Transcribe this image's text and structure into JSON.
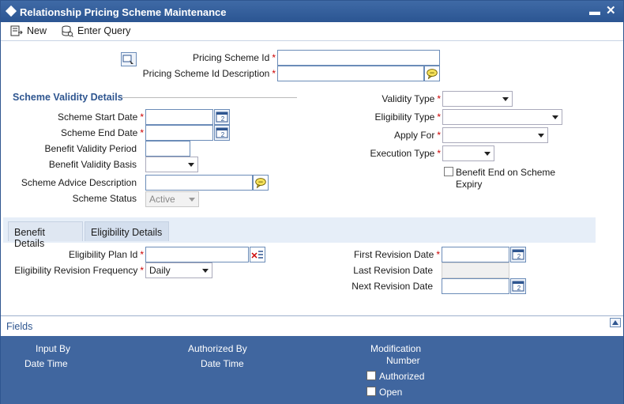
{
  "window": {
    "title": "Relationship Pricing Scheme Maintenance",
    "minimize": "▬",
    "close": "✕"
  },
  "toolbar": {
    "new_label": "New",
    "enter_query_label": "Enter Query"
  },
  "header_fields": {
    "pricing_scheme_id_label": "Pricing Scheme Id",
    "pricing_scheme_id_value": "",
    "pricing_scheme_desc_label": "Pricing Scheme Id Description",
    "pricing_scheme_desc_value": ""
  },
  "required_mark": "*",
  "scheme_validity": {
    "section_title": "Scheme Validity Details",
    "start_date_label": "Scheme Start Date",
    "start_date_value": "",
    "end_date_label": "Scheme End Date",
    "end_date_value": "",
    "benefit_validity_period_label": "Benefit Validity Period",
    "benefit_validity_period_value": "",
    "benefit_validity_basis_label": "Benefit Validity Basis",
    "benefit_validity_basis_value": "",
    "advice_description_label": "Scheme Advice Description",
    "advice_description_value": "",
    "scheme_status_label": "Scheme Status",
    "scheme_status_value": "Active"
  },
  "right_fields": {
    "validity_type_label": "Validity Type",
    "validity_type_value": "",
    "eligibility_type_label": "Eligibility Type",
    "eligibility_type_value": "",
    "apply_for_label": "Apply For",
    "apply_for_value": "",
    "execution_type_label": "Execution Type",
    "execution_type_value": "",
    "benefit_end_label_line1": "Benefit End on Scheme",
    "benefit_end_label_line2": "Expiry",
    "benefit_end_checked": false
  },
  "tabs": [
    {
      "label": "Benefit Details"
    },
    {
      "label": "Eligibility Details"
    }
  ],
  "eligibility": {
    "plan_id_label": "Eligibility Plan Id",
    "plan_id_value": "",
    "revision_frequency_label": "Eligibility Revision Frequency",
    "revision_frequency_value": "Daily",
    "first_revision_label": "First Revision Date",
    "first_revision_value": "",
    "last_revision_label": "Last Revision Date",
    "last_revision_value": "",
    "next_revision_label": "Next Revision Date",
    "next_revision_value": ""
  },
  "fields_bar": {
    "label": "Fields"
  },
  "footer": {
    "input_by": "Input By",
    "date_time_1": "Date Time",
    "authorized_by": "Authorized By",
    "date_time_2": "Date Time",
    "modification": "Modification",
    "number": "Number",
    "authorized": "Authorized",
    "open": "Open"
  },
  "colors": {
    "titlebar": "#2f5690",
    "footer": "#40669f",
    "section_title": "#2f5690",
    "required": "#cc0000"
  }
}
